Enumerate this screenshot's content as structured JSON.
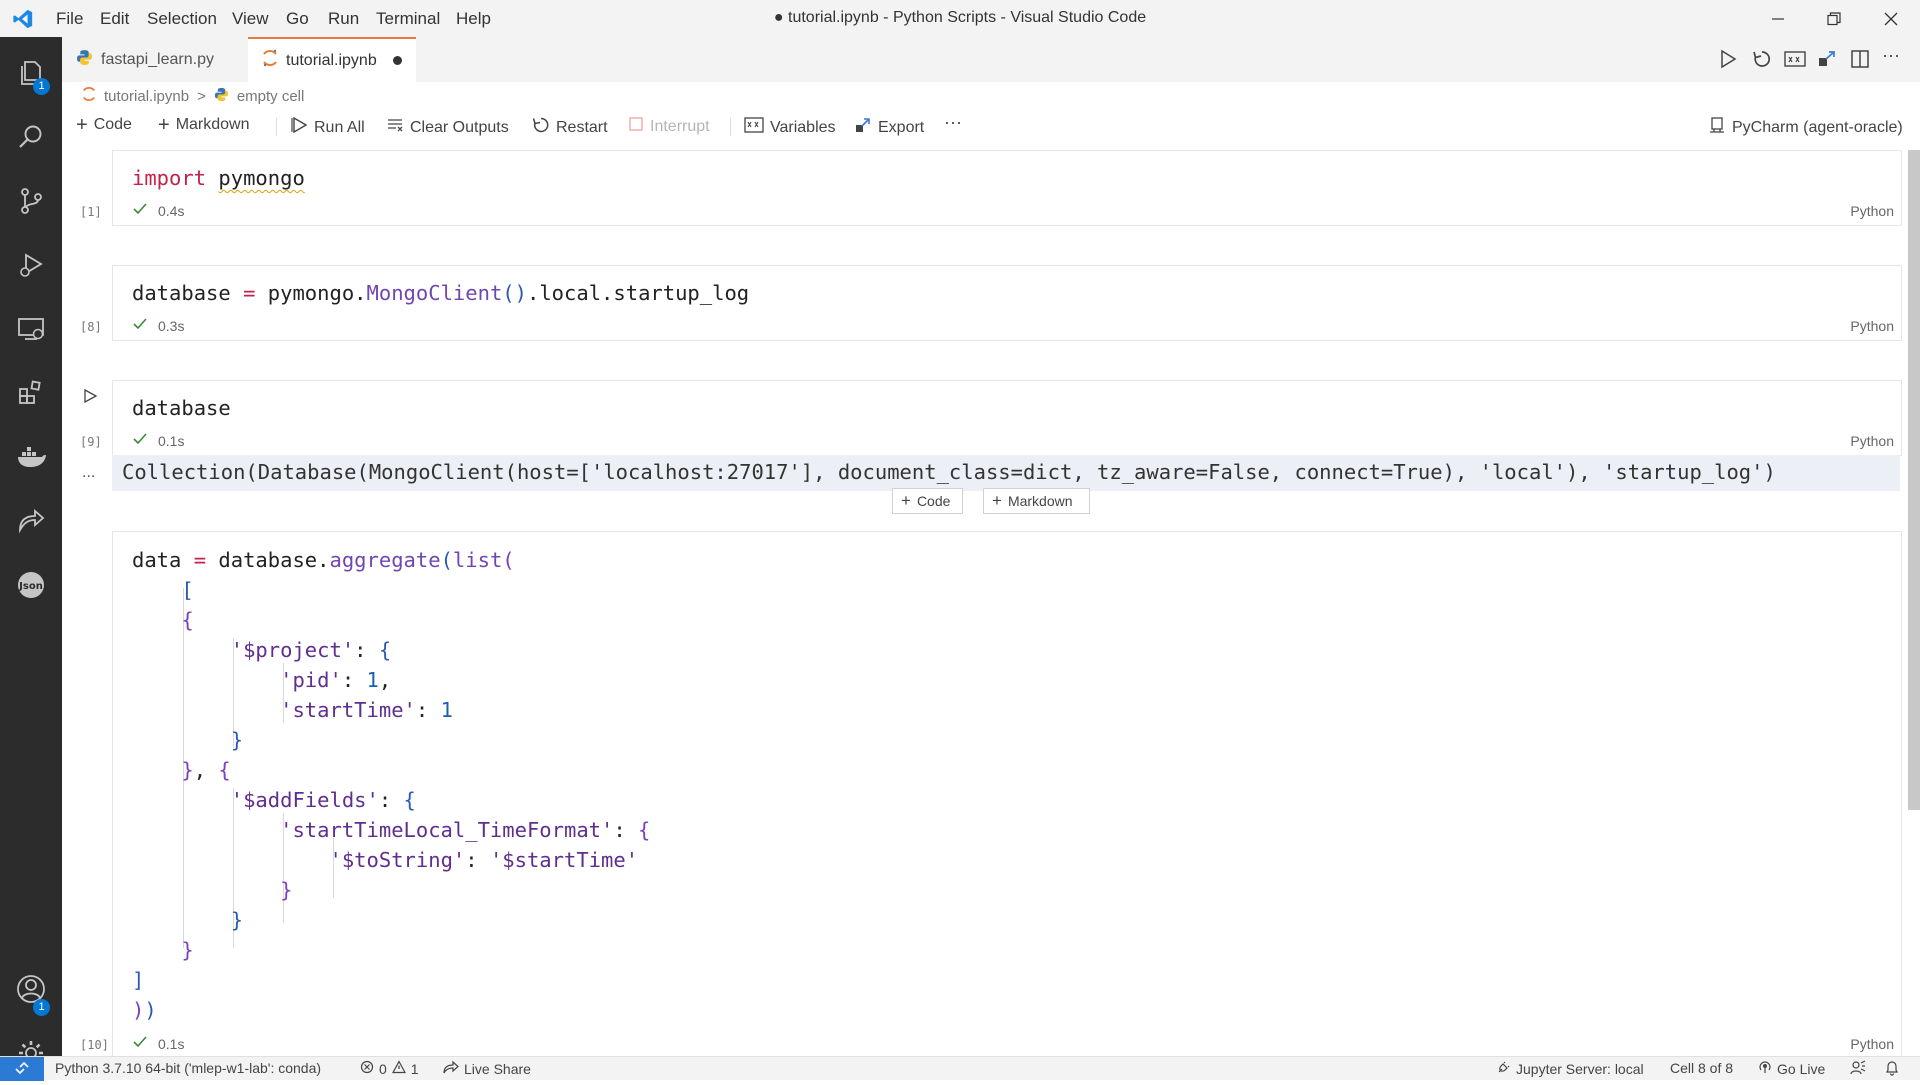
{
  "menu": [
    "File",
    "Edit",
    "Selection",
    "View",
    "Go",
    "Run",
    "Terminal",
    "Help"
  ],
  "window_title": "● tutorial.ipynb - Python Scripts - Visual Studio Code",
  "tabs": [
    {
      "label": "fastapi_learn.py",
      "active": false
    },
    {
      "label": "tutorial.ipynb",
      "active": true,
      "dirty": true
    }
  ],
  "breadcrumb": {
    "file": "tutorial.ipynb",
    "separator": ">",
    "cell": "empty cell"
  },
  "toolbar": {
    "code": "Code",
    "markdown": "Markdown",
    "run_all": "Run All",
    "clear_outputs": "Clear Outputs",
    "restart": "Restart",
    "interrupt": "Interrupt",
    "variables": "Variables",
    "export": "Export",
    "more": "···",
    "kernel": "PyCharm (agent-oracle)"
  },
  "activity_badges": {
    "explorer": "1",
    "accounts": "1"
  },
  "cells": [
    {
      "exec": "[1]",
      "time": "0.4s",
      "lang": "Python"
    },
    {
      "exec": "[8]",
      "time": "0.3s",
      "lang": "Python"
    },
    {
      "exec": "[9]",
      "time": "0.1s",
      "lang": "Python"
    },
    {
      "exec": "[10]",
      "time": "0.1s",
      "lang": "Python"
    }
  ],
  "output_text": "Collection(Database(MongoClient(host=['localhost:27017'], document_class=dict, tz_aware=False, connect=True), 'local'), 'startup_log')",
  "output_more": "...",
  "add_cell": {
    "code": "Code",
    "markdown": "Markdown"
  },
  "statusbar": {
    "interpreter": "Python 3.7.10 64-bit ('mlep-w1-lab': conda)",
    "errors": "0",
    "warnings": "1",
    "live_share": "Live Share",
    "jupyter": "Jupyter Server: local",
    "cell_pos": "Cell 8 of 8",
    "go_live": "Go Live"
  },
  "colors": {
    "accent": "#0078d4",
    "tab_active_border": "#e87b3c",
    "activity_bg": "#2c2c2c",
    "remote_bg": "#2b7bd5"
  }
}
